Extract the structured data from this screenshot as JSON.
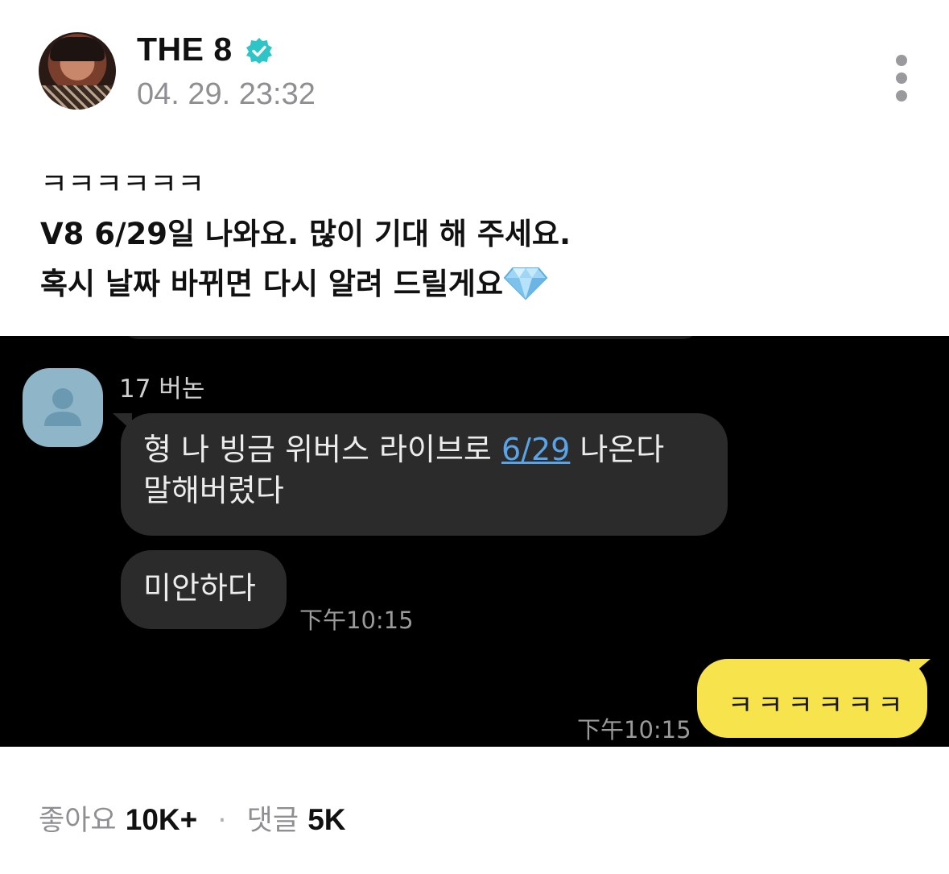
{
  "post": {
    "author": "THE 8",
    "verified": true,
    "timestamp": "04. 29. 23:32",
    "lines": [
      "ㅋㅋㅋㅋㅋㅋ",
      "V8 6/29일 나와요. 많이 기대 해 주세요.",
      "혹시 날짜 바뀌면 다시 알려 드릴게요"
    ],
    "emoji": "gem-stone"
  },
  "screenshot": {
    "friend_name": "17 버논",
    "messages": [
      {
        "pre": "형 나 빙금 위버스 라이브로 ",
        "link": "6/29",
        "post": " 나온다",
        "line2": "말해버렸다"
      },
      {
        "text": "미안하다"
      }
    ],
    "friend_time": "下午10:15",
    "my_message": "ㅋㅋㅋㅋㅋㅋ",
    "my_time": "下午10:15"
  },
  "footer": {
    "likes_label": "좋아요",
    "likes_count": "10K+",
    "separator": "·",
    "comments_label": "댓글",
    "comments_count": "5K"
  },
  "colors": {
    "verified": "#2ec5c8",
    "my_bubble": "#f7e34b",
    "friend_bubble": "#2b2b2b",
    "link": "#5aa3e6"
  }
}
